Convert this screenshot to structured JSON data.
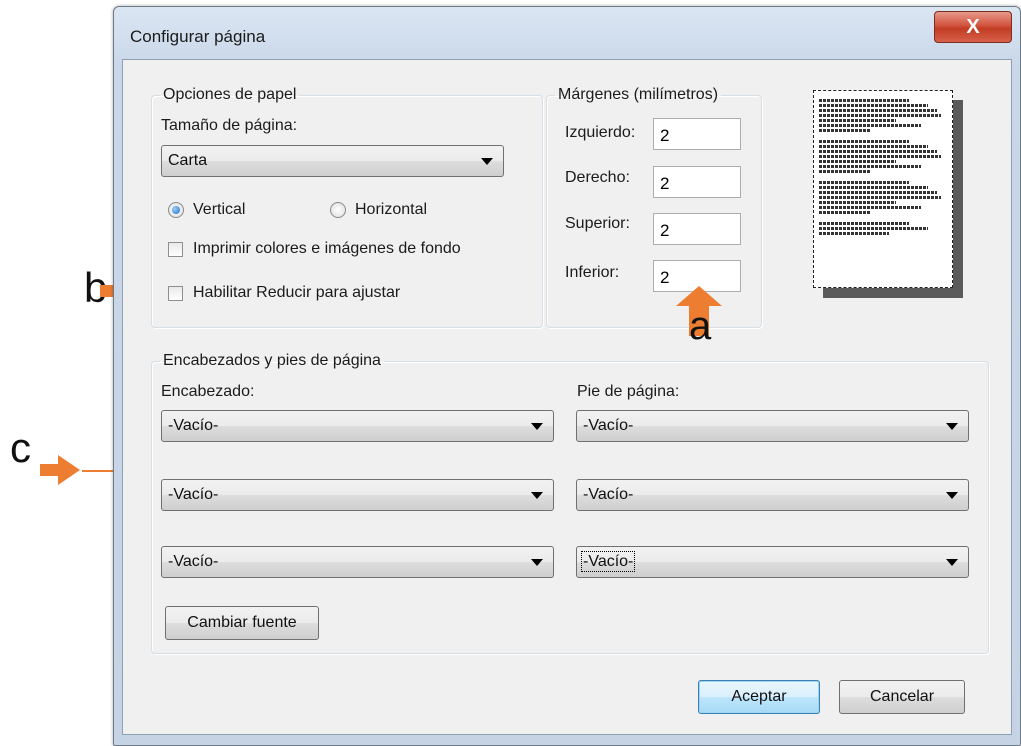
{
  "window": {
    "title": "Configurar página",
    "close_glyph": "X"
  },
  "paper_options": {
    "legend": "Opciones de papel",
    "size_label": "Tamaño de página:",
    "size_value": "Carta",
    "orientation_vertical": "Vertical",
    "orientation_horizontal": "Horizontal",
    "orientation_selected": "Vertical",
    "print_bg_label": "Imprimir colores e imágenes de fondo",
    "print_bg_checked": false,
    "shrink_label": "Habilitar Reducir para ajustar",
    "shrink_checked": false
  },
  "margins": {
    "legend": "Márgenes (milímetros)",
    "left_label": "Izquierdo:",
    "left_value": "2",
    "right_label": "Derecho:",
    "right_value": "2",
    "top_label": "Superior:",
    "top_value": "2",
    "bottom_label": "Inferior:",
    "bottom_value": "2"
  },
  "headers_footers": {
    "legend": "Encabezados y pies de página",
    "header_label": "Encabezado:",
    "footer_label": "Pie de página:",
    "header_values": [
      "-Vacío-",
      "-Vacío-",
      "-Vacío-"
    ],
    "footer_values": [
      "-Vacío-",
      "-Vacío-",
      "-Vacío-"
    ],
    "change_font_label": "Cambiar fuente"
  },
  "buttons": {
    "ok": "Aceptar",
    "cancel": "Cancelar"
  },
  "annotations": {
    "a": "a",
    "b": "b",
    "c": "c",
    "arrow_color": "#ed7d31"
  },
  "icons": {
    "close": "close-icon",
    "dropdown": "chevron-down-icon"
  }
}
